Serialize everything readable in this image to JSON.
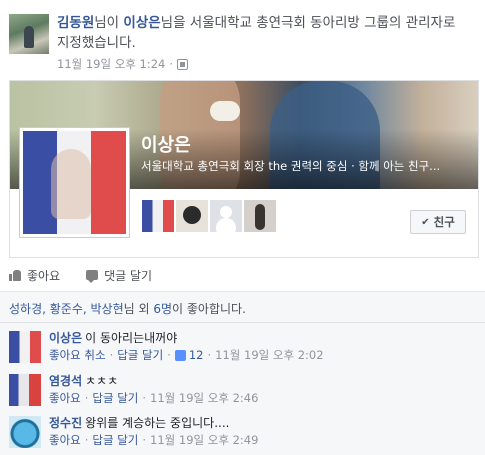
{
  "story": {
    "actor": "김동원",
    "text_after_actor": "님이 ",
    "target": "이상은",
    "text_after_target": "님을 서울대학교 총연극회 동아리방 그룹의 관리자로 지정했습니다.",
    "timestamp": "11월 19일 오후 1:24",
    "privacy_icon": "members-icon"
  },
  "group": {
    "name": "이상은",
    "description": "서울대학교 총연극회 회장 the 권력의 중심 · 함께 아는 친구...",
    "friend_button_label": "친구",
    "friend_check": "✔"
  },
  "actions": {
    "like_label": "좋아요",
    "comment_label": "댓글 달기"
  },
  "likes_summary": {
    "names": "성하경, 황준수, 박상현",
    "text_mid": "님 외 ",
    "others": "6명",
    "text_end": "이 좋아합니다."
  },
  "comments": [
    {
      "author": "이상은",
      "text": "이 동아리는내꺼야",
      "like_label": "좋아요 취소",
      "reply_label": "답글 달기",
      "like_count": "12",
      "timestamp": "11월 19일 오후 2:02"
    },
    {
      "author": "염경석",
      "text": "ㅊㅊㅊ",
      "like_label": "좋아요",
      "reply_label": "답글 달기",
      "timestamp": "11월 19일 오후 2:46"
    },
    {
      "author": "정수진",
      "text": "왕위를 계승하는 중입니다....",
      "like_label": "좋아요",
      "reply_label": "답글 달기",
      "timestamp": "11월 19일 오후 2:49"
    }
  ],
  "dot": "·"
}
